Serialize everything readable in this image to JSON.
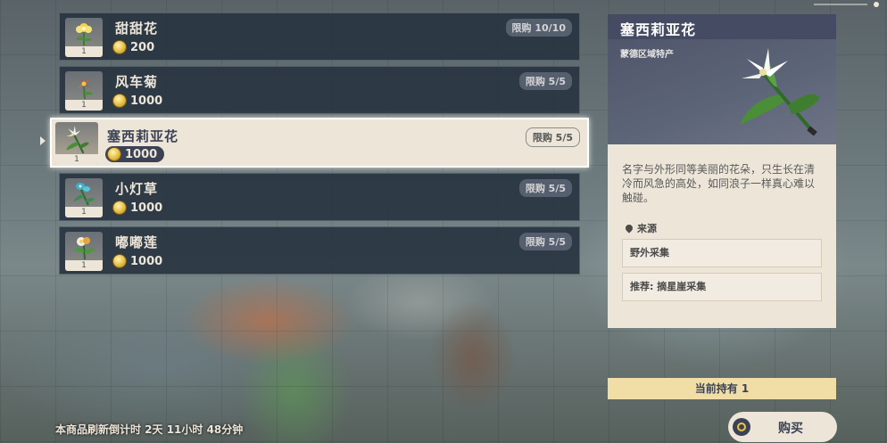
{
  "items": [
    {
      "name": "甜甜花",
      "price": "200",
      "limit": "限购 10/10",
      "qty": "1",
      "icon": "sweet-flower-icon"
    },
    {
      "name": "风车菊",
      "price": "1000",
      "limit": "限购 5/5",
      "qty": "1",
      "icon": "windwheel-aster-icon"
    },
    {
      "name": "塞西莉亚花",
      "price": "1000",
      "limit": "限购 5/5",
      "qty": "1",
      "icon": "cecilia-icon"
    },
    {
      "name": "小灯草",
      "price": "1000",
      "limit": "限购 5/5",
      "qty": "1",
      "icon": "small-lamp-grass-icon"
    },
    {
      "name": "嘟嘟莲",
      "price": "1000",
      "limit": "限购 5/5",
      "qty": "1",
      "icon": "calla-lily-icon"
    }
  ],
  "selected_index": 2,
  "detail": {
    "title": "塞西莉亚花",
    "subtitle": "蒙德区域特产",
    "description": "名字与外形同等美丽的花朵，只生长在清冷而风急的高处，如同浪子一样真心难以触碰。",
    "source_label": "来源",
    "sources": [
      "野外采集",
      "推荐: 摘星崖采集"
    ]
  },
  "owned_text": "当前持有 1",
  "buy_label": "购买",
  "refresh_text": "本商品刷新倒计时 2天 11小时 48分钟",
  "colors": {
    "panel_dark": "#283440",
    "panel_light": "#ece5d8",
    "title_bar": "#444b63",
    "owned_bar": "#f1dea6",
    "coin": "#e8c24a"
  }
}
